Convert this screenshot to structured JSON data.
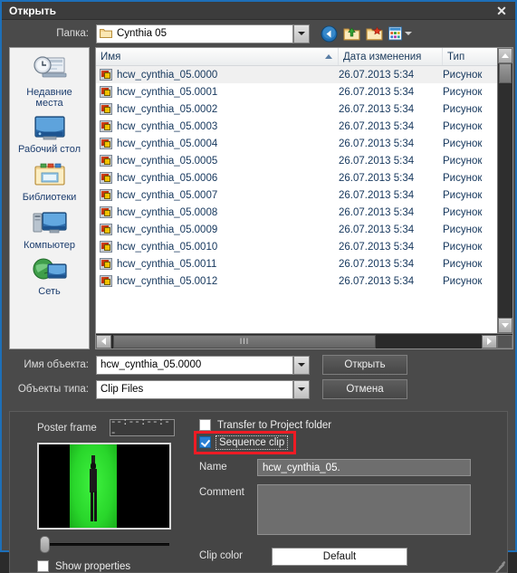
{
  "window": {
    "title": "Открыть",
    "close_icon": "close-icon"
  },
  "path_row": {
    "label": "Папка:",
    "value": "Cynthia 05",
    "folder_icon": "folder-icon",
    "dropdown_icon": "chevron-down-icon",
    "toolbar": [
      {
        "name": "back-button",
        "icon": "back-arrow-icon"
      },
      {
        "name": "up-one-level-button",
        "icon": "folder-up-icon"
      },
      {
        "name": "new-folder-button",
        "icon": "new-folder-icon"
      },
      {
        "name": "views-button",
        "icon": "views-grid-icon"
      }
    ]
  },
  "places": [
    {
      "label": "Недавние места",
      "icon": "recent-places-icon"
    },
    {
      "label": "Рабочий стол",
      "icon": "desktop-icon"
    },
    {
      "label": "Библиотеки",
      "icon": "libraries-icon"
    },
    {
      "label": "Компьютер",
      "icon": "computer-icon"
    },
    {
      "label": "Сеть",
      "icon": "network-icon"
    }
  ],
  "filelist": {
    "columns": [
      "Имя",
      "Дата изменения",
      "Тип"
    ],
    "sorted_column": "Имя",
    "sort_direction": "ascending",
    "rows": [
      {
        "name": "hcw_cynthia_05.0000",
        "date": "26.07.2013 5:34",
        "type": "Рисунок",
        "selected": true
      },
      {
        "name": "hcw_cynthia_05.0001",
        "date": "26.07.2013 5:34",
        "type": "Рисунок",
        "selected": false
      },
      {
        "name": "hcw_cynthia_05.0002",
        "date": "26.07.2013 5:34",
        "type": "Рисунок",
        "selected": false
      },
      {
        "name": "hcw_cynthia_05.0003",
        "date": "26.07.2013 5:34",
        "type": "Рисунок",
        "selected": false
      },
      {
        "name": "hcw_cynthia_05.0004",
        "date": "26.07.2013 5:34",
        "type": "Рисунок",
        "selected": false
      },
      {
        "name": "hcw_cynthia_05.0005",
        "date": "26.07.2013 5:34",
        "type": "Рисунок",
        "selected": false
      },
      {
        "name": "hcw_cynthia_05.0006",
        "date": "26.07.2013 5:34",
        "type": "Рисунок",
        "selected": false
      },
      {
        "name": "hcw_cynthia_05.0007",
        "date": "26.07.2013 5:34",
        "type": "Рисунок",
        "selected": false
      },
      {
        "name": "hcw_cynthia_05.0008",
        "date": "26.07.2013 5:34",
        "type": "Рисунок",
        "selected": false
      },
      {
        "name": "hcw_cynthia_05.0009",
        "date": "26.07.2013 5:34",
        "type": "Рисунок",
        "selected": false
      },
      {
        "name": "hcw_cynthia_05.0010",
        "date": "26.07.2013 5:34",
        "type": "Рисунок",
        "selected": false
      },
      {
        "name": "hcw_cynthia_05.0011",
        "date": "26.07.2013 5:34",
        "type": "Рисунок",
        "selected": false
      },
      {
        "name": "hcw_cynthia_05.0012",
        "date": "26.07.2013 5:34",
        "type": "Рисунок",
        "selected": false
      }
    ],
    "hscroll_grip": "III"
  },
  "form": {
    "filename_label": "Имя объекта:",
    "filename_value": "hcw_cynthia_05.0000",
    "filetype_label": "Объекты типа:",
    "filetype_value": "Clip Files",
    "open_button": "Открыть",
    "cancel_button": "Отмена"
  },
  "bottom": {
    "poster_frame_label": "Poster frame",
    "poster_frame_value": "--:--:--:--",
    "show_properties_label": "Show properties",
    "show_properties_checked": false,
    "transfer_label": "Transfer to Project folder",
    "transfer_checked": false,
    "sequence_label": "Sequence clip",
    "sequence_checked": true,
    "name_label": "Name",
    "name_value": "hcw_cynthia_05.",
    "comment_label": "Comment",
    "comment_value": "",
    "clip_color_label": "Clip color",
    "clip_color_value": "Default"
  },
  "colors": {
    "dialog_bg": "#4a4a4a",
    "titlebar_bg": "#3c3c3c",
    "window_border": "#1d6fb8",
    "highlight_red": "#ee1b24",
    "checkbox_blue": "#2a7fd4",
    "list_text": "#14365c",
    "places_bg": "#f2f2f2",
    "green_screen": "#29d62b"
  }
}
